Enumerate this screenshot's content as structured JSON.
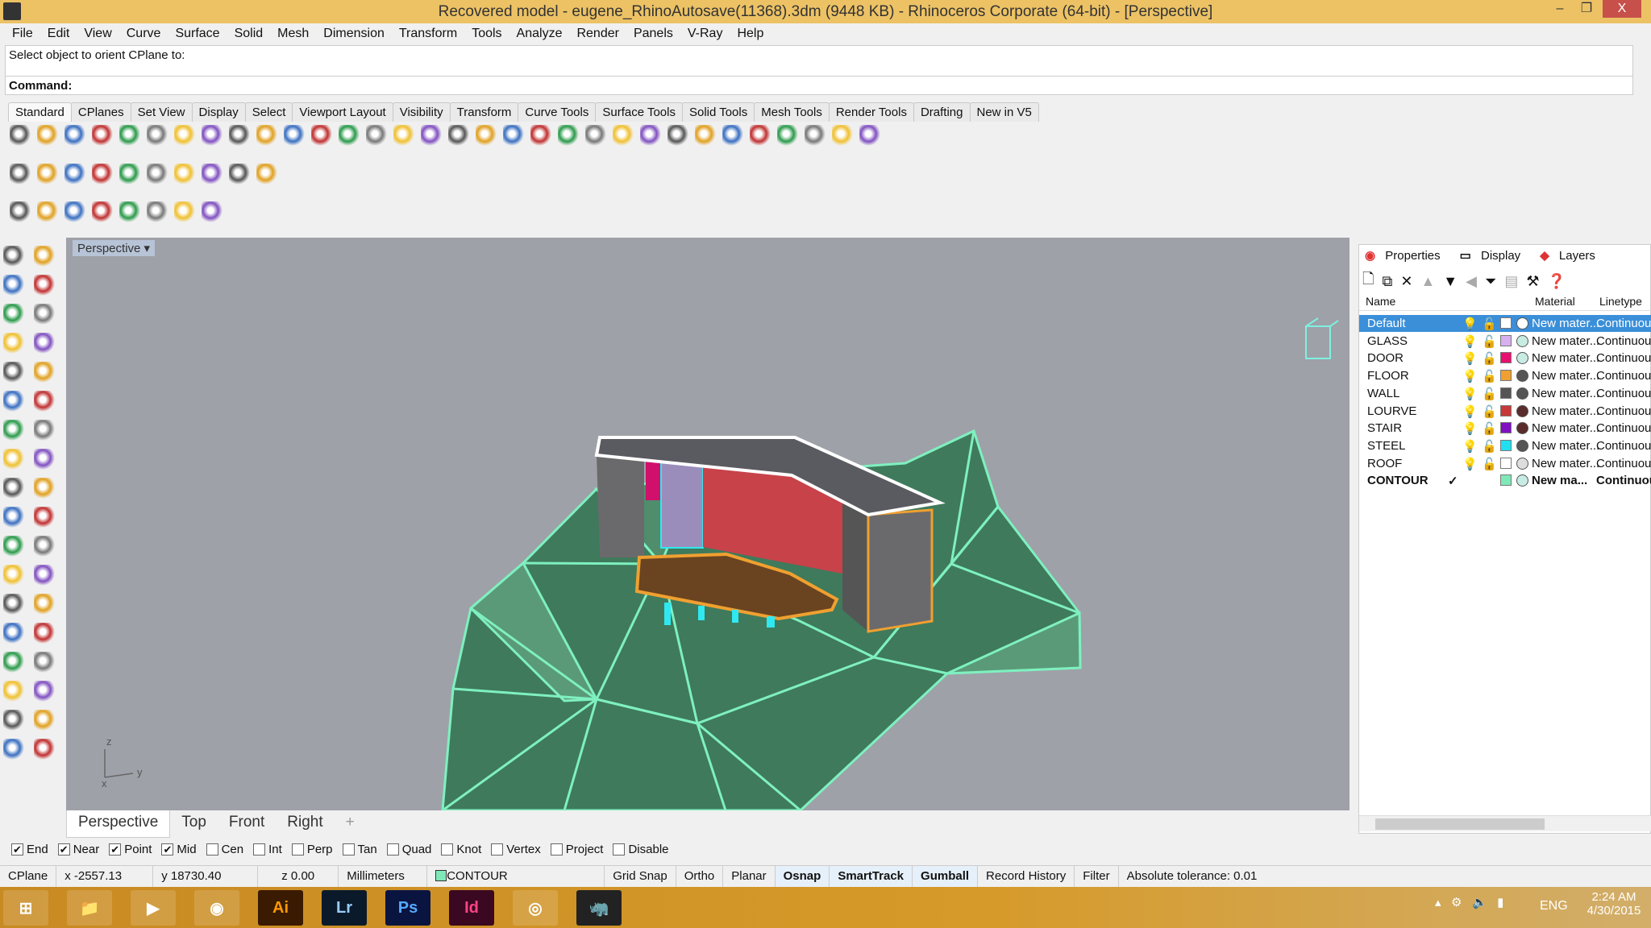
{
  "window": {
    "title": "Recovered model - eugene_RhinoAutosave(11368).3dm (9448 KB) - Rhinoceros Corporate (64-bit) - [Perspective]",
    "minimize": "–",
    "restore": "❐",
    "close": "X"
  },
  "menu": [
    "File",
    "Edit",
    "View",
    "Curve",
    "Surface",
    "Solid",
    "Mesh",
    "Dimension",
    "Transform",
    "Tools",
    "Analyze",
    "Render",
    "Panels",
    "V-Ray",
    "Help"
  ],
  "command": {
    "history": "Select object to orient CPlane to:",
    "prompt": "Command:"
  },
  "toolbar_tabs": [
    "Standard",
    "CPlanes",
    "Set View",
    "Display",
    "Select",
    "Viewport Layout",
    "Visibility",
    "Transform",
    "Curve Tools",
    "Surface Tools",
    "Solid Tools",
    "Mesh Tools",
    "Render Tools",
    "Drafting",
    "New in V5"
  ],
  "toolbar_row1": [
    "new-icon",
    "open-icon",
    "save-icon",
    "print-icon",
    "export-icon",
    "cut-icon",
    "copy-icon",
    "paste-icon",
    "undo-icon",
    "pan-icon",
    "rotate-view-icon",
    "zoom-icon",
    "zoom-window-icon",
    "zoom-extents-icon",
    "zoom-selected-icon",
    "rotate-icon",
    "four-viewports-icon",
    "car-icon",
    "render-icon",
    "circle-icon",
    "grid-icon",
    "light-icon",
    "lock-icon",
    "shield-icon",
    "color-wheel-icon",
    "sphere-icon",
    "sphere-dark-icon",
    "sphere-blue-icon",
    "filter-icon",
    "gear-icon",
    "dimension-icon",
    "help-icon"
  ],
  "toolbar_row2": [
    "vray-m-icon",
    "vray-tag-icon",
    "vray-tags-icon",
    "vray-r-icon",
    "vray-rt-icon",
    "vray-lights-icon",
    "vray-sun-icon",
    "vray-plane-icon",
    "vray-fur-icon",
    "vray-help-icon"
  ],
  "toolbar_row3": [
    "sun-icon",
    "plane-light-icon",
    "sphere-light-icon",
    "dome-light-icon",
    "mesh-light-icon",
    "spot-light-icon",
    "ies-light-icon",
    "arrow-light-icon"
  ],
  "left_tools": [
    "select-icon",
    "point-icon",
    "polyline-icon",
    "curve-icon",
    "circle-icon",
    "arc-icon",
    "polygon-icon",
    "rectangle-icon",
    "ellipse-icon",
    "fillet-icon",
    "surface-icon",
    "loft-icon",
    "box-icon",
    "boolean-icon",
    "extrude-icon",
    "plane-icon",
    "explode-icon",
    "trim-icon",
    "split-icon",
    "join-icon",
    "group-icon",
    "ungroup-icon",
    "offset-icon",
    "blend-icon",
    "text-icon",
    "scale-icon",
    "array-icon",
    "align-icon",
    "mesh-icon",
    "dimension-icon",
    "grid-array-icon",
    "snap-icon",
    "analyze-icon",
    "check-icon",
    "render-icon",
    "paint-icon"
  ],
  "viewport": {
    "label": "Perspective",
    "axes": {
      "z": "z",
      "y": "y",
      "x": "x"
    },
    "tabs": [
      "Perspective",
      "Top",
      "Front",
      "Right"
    ],
    "add_tab": "+"
  },
  "panel": {
    "tabs": [
      "Properties",
      "Display",
      "Layers"
    ],
    "columns": {
      "name": "Name",
      "material": "Material",
      "linetype": "Linetype"
    },
    "layers": [
      {
        "name": "Default",
        "color": "#ffffff",
        "mat": "#ffffff",
        "material": "New mater...",
        "linetype": "Continuous",
        "selected": true
      },
      {
        "name": "GLASS",
        "color": "#d8b0f0",
        "mat": "#c8ece4",
        "material": "New mater...",
        "linetype": "Continuous"
      },
      {
        "name": "DOOR",
        "color": "#e8106e",
        "mat": "#c8ece4",
        "material": "New mater...",
        "linetype": "Continuous"
      },
      {
        "name": "FLOOR",
        "color": "#f0a030",
        "mat": "#555555",
        "material": "New mater...",
        "linetype": "Continuous"
      },
      {
        "name": "WALL",
        "color": "#555555",
        "mat": "#555555",
        "material": "New mater...",
        "linetype": "Continuous"
      },
      {
        "name": "LOURVE",
        "color": "#c83838",
        "mat": "#5a2c2c",
        "material": "New mater...",
        "linetype": "Continuous"
      },
      {
        "name": "STAIR",
        "color": "#8010c0",
        "mat": "#5a2c2c",
        "material": "New mater...",
        "linetype": "Continuous"
      },
      {
        "name": "STEEL",
        "color": "#20e0f0",
        "mat": "#555555",
        "material": "New mater...",
        "linetype": "Continuous"
      },
      {
        "name": "ROOF",
        "color": "#ffffff",
        "mat": "#dddddd",
        "material": "New mater...",
        "linetype": "Continuous"
      },
      {
        "name": "CONTOUR",
        "color": "#80e8b8",
        "mat": "#c8ece4",
        "material": "New ma...",
        "linetype": "Continuous",
        "current": true,
        "check": "✓"
      }
    ]
  },
  "osnap": [
    {
      "l": "End",
      "c": true
    },
    {
      "l": "Near",
      "c": true
    },
    {
      "l": "Point",
      "c": true
    },
    {
      "l": "Mid",
      "c": true
    },
    {
      "l": "Cen",
      "c": false
    },
    {
      "l": "Int",
      "c": false
    },
    {
      "l": "Perp",
      "c": false
    },
    {
      "l": "Tan",
      "c": false
    },
    {
      "l": "Quad",
      "c": false
    },
    {
      "l": "Knot",
      "c": false
    },
    {
      "l": "Vertex",
      "c": false
    },
    {
      "l": "Project",
      "c": false
    },
    {
      "l": "Disable",
      "c": false
    }
  ],
  "status": {
    "cplane": "CPlane",
    "x": "x -2557.13",
    "y": "y 18730.40",
    "z": "z 0.00",
    "units": "Millimeters",
    "layer": "CONTOUR",
    "grid_snap": "Grid Snap",
    "ortho": "Ortho",
    "planar": "Planar",
    "osnap": "Osnap",
    "smarttrack": "SmartTrack",
    "gumball": "Gumball",
    "record_history": "Record History",
    "filter": "Filter",
    "tolerance": "Absolute tolerance: 0.01"
  },
  "taskbar": {
    "apps": [
      {
        "n": "start",
        "t": "⊞"
      },
      {
        "n": "file-explorer",
        "t": "📁"
      },
      {
        "n": "media-player",
        "t": "▶"
      },
      {
        "n": "steam",
        "t": "◉"
      },
      {
        "n": "illustrator",
        "t": "Ai"
      },
      {
        "n": "lightroom",
        "t": "Lr"
      },
      {
        "n": "photoshop",
        "t": "Ps"
      },
      {
        "n": "indesign",
        "t": "Id"
      },
      {
        "n": "chrome",
        "t": "◎"
      },
      {
        "n": "rhino",
        "t": "🦏"
      }
    ],
    "lang": "ENG",
    "time": "2:24 AM",
    "date": "4/30/2015"
  }
}
